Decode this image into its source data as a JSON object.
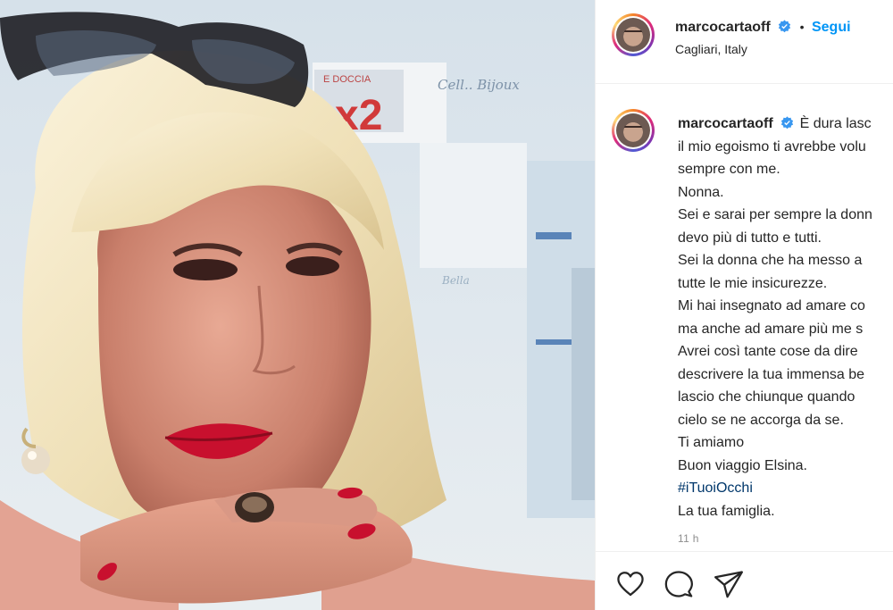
{
  "post": {
    "username": "marcocartaoff",
    "separator": "•",
    "follow_label": "Segui",
    "location": "Cagliari, Italy",
    "caption_lines": [
      "È dura lasc",
      "il mio egoismo ti avrebbe volu",
      "sempre con me.",
      "Nonna.",
      "Sei e sarai per sempre la donn",
      "devo più di tutto e tutti.",
      "Sei la donna che ha messo a",
      "tutte le mie insicurezze.",
      "Mi hai insegnato ad amare co",
      "ma anche ad amare più me s",
      "Avrei così tante cose da dire",
      "descrivere la tua immensa be",
      "lascio che chiunque quando",
      "cielo se ne accorga da se.",
      "Ti amiamo",
      "Buon viaggio Elsina."
    ],
    "hashtag": "#iTuoiOcchi",
    "signoff": "La tua famiglia.",
    "timestamp": "11 h"
  },
  "photo": {
    "sign_text": "x2",
    "sign_small": "E DOCCIA",
    "script_text": "Cell.. Bijoux",
    "script_text_2": "Bella"
  },
  "icons": [
    "verified-badge-icon",
    "heart-icon",
    "comment-icon",
    "share-icon"
  ],
  "colors": {
    "accent": "#0095f6",
    "hashtag": "#00376b",
    "muted": "#8e8e8e",
    "verified": "#3897f0"
  }
}
